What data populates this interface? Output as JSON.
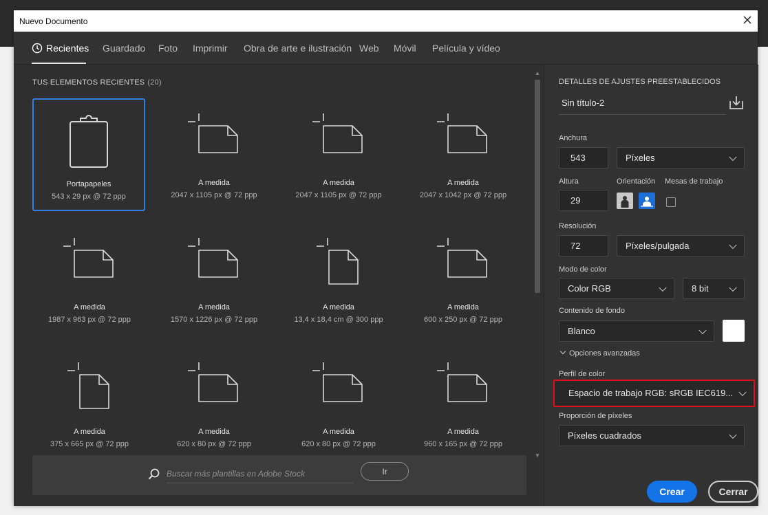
{
  "window": {
    "title": "Nuevo Documento"
  },
  "tabs": [
    {
      "label": "Recientes",
      "active": true
    },
    {
      "label": "Guardado"
    },
    {
      "label": "Foto"
    },
    {
      "label": "Imprimir"
    },
    {
      "label": "Obra de arte e ilustración"
    },
    {
      "label": "Web"
    },
    {
      "label": "Móvil"
    },
    {
      "label": "Película y vídeo"
    }
  ],
  "recent": {
    "title": "TUS ELEMENTOS RECIENTES",
    "count": "(20)",
    "items": [
      {
        "name": "Portapapeles",
        "dims": "543 x 29 px @ 72 ppp",
        "icon": "clipboard-icon",
        "selected": true
      },
      {
        "name": "A medida",
        "dims": "2047 x 1105 px @ 72 ppp",
        "icon": "landscape-doc-icon"
      },
      {
        "name": "A medida",
        "dims": "2047 x 1105 px @ 72 ppp",
        "icon": "landscape-doc-icon"
      },
      {
        "name": "A medida",
        "dims": "2047 x 1042 px @ 72 ppp",
        "icon": "landscape-doc-icon"
      },
      {
        "name": "A medida",
        "dims": "1987 x 963 px @ 72 ppp",
        "icon": "landscape-doc-icon"
      },
      {
        "name": "A medida",
        "dims": "1570 x 1226 px @ 72 ppp",
        "icon": "landscape-doc-icon"
      },
      {
        "name": "A medida",
        "dims": "13,4 x 18,4 cm @ 300 ppp",
        "icon": "portrait-doc-icon"
      },
      {
        "name": "A medida",
        "dims": "600 x 250 px @ 72 ppp",
        "icon": "landscape-doc-icon"
      },
      {
        "name": "A medida",
        "dims": "375 x 665 px @ 72 ppp",
        "icon": "portrait-doc-icon"
      },
      {
        "name": "A medida",
        "dims": "620 x 80 px @ 72 ppp",
        "icon": "landscape-doc-icon"
      },
      {
        "name": "A medida",
        "dims": "620 x 80 px @ 72 ppp",
        "icon": "landscape-doc-icon"
      },
      {
        "name": "A medida",
        "dims": "960 x 165 px @ 72 ppp",
        "icon": "landscape-doc-icon"
      }
    ]
  },
  "stock": {
    "placeholder": "Buscar más plantillas en Adobe Stock",
    "go_label": "Ir"
  },
  "details": {
    "title": "DETALLES DE AJUSTES PREESTABLECIDOS",
    "doc_name": "Sin título-2",
    "width_label": "Anchura",
    "width_value": "543",
    "width_unit": "Píxeles",
    "height_label": "Altura",
    "height_value": "29",
    "orientation_label": "Orientación",
    "artboards_label": "Mesas de trabajo",
    "resolution_label": "Resolución",
    "resolution_value": "72",
    "resolution_unit": "Píxeles/pulgada",
    "color_mode_label": "Modo de color",
    "color_mode": "Color RGB",
    "bit_depth": "8 bit",
    "background_label": "Contenido de fondo",
    "background": "Blanco",
    "advanced_label": "Opciones avanzadas",
    "profile_label": "Perfil de color",
    "profile": "Espacio de trabajo RGB: sRGB IEC619...",
    "pixel_ratio_label": "Proporción de píxeles",
    "pixel_ratio": "Píxeles cuadrados",
    "create_label": "Crear",
    "close_label": "Cerrar"
  },
  "colors": {
    "accent": "#1473e6",
    "highlight": "#e0101b",
    "selection": "#2f7fe0"
  }
}
